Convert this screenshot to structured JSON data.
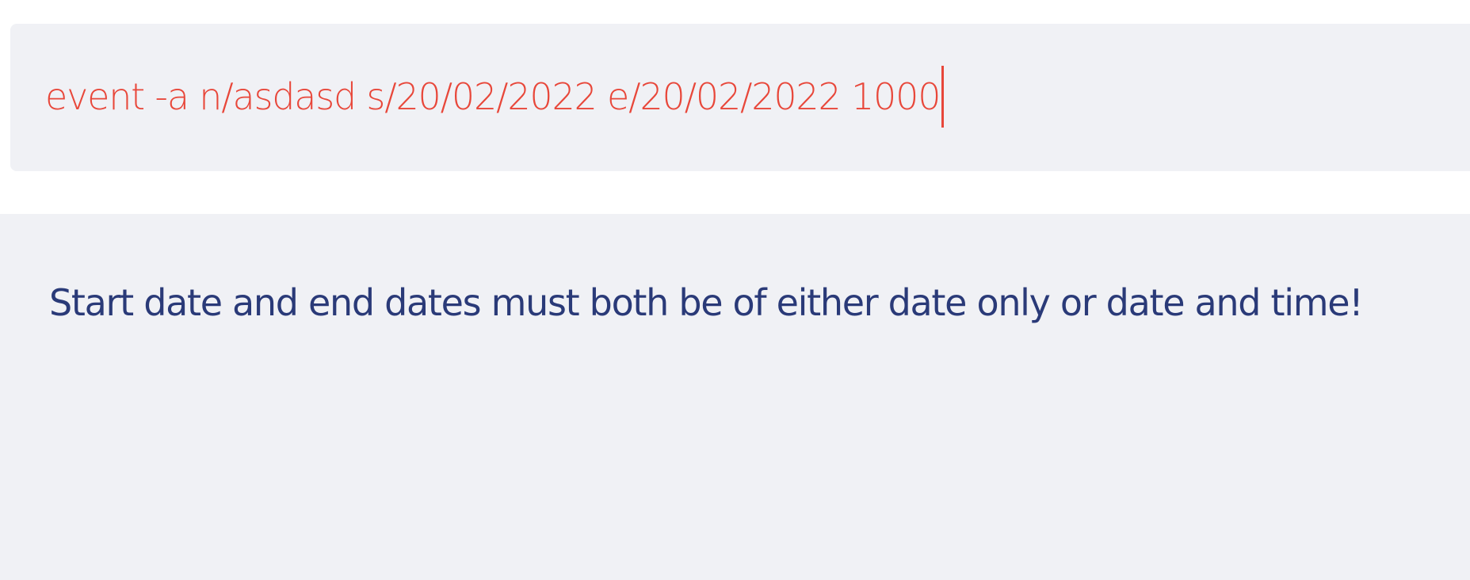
{
  "command_box": {
    "input_value": "event -a n/asdasd s/20/02/2022 e/20/02/2022 1000",
    "text_color": "#e8473a"
  },
  "result_display": {
    "message": "Start date and end dates must both be of either date only or date and time!",
    "text_color": "#2a3a78"
  },
  "colors": {
    "panel_background": "#f0f1f5",
    "page_background": "#ffffff"
  }
}
